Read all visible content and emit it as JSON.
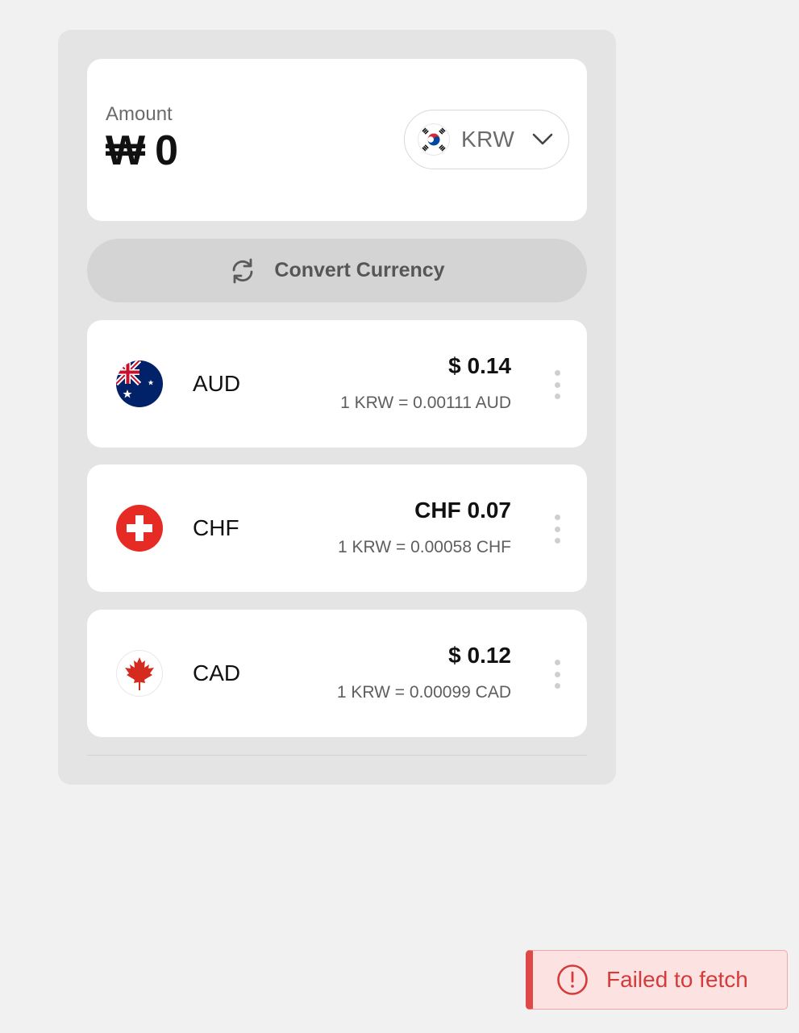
{
  "amount": {
    "label": "Amount",
    "symbol": "₩",
    "value": "0"
  },
  "currency_select": {
    "code": "KRW",
    "flag_icon": "south-korea-flag-icon"
  },
  "convert_button": {
    "label": "Convert Currency",
    "icon": "refresh-icon"
  },
  "rates": [
    {
      "code": "AUD",
      "converted": "$ 0.14",
      "rate": "1 KRW = 0.00111 AUD",
      "flag_icon": "australia-flag-icon"
    },
    {
      "code": "CHF",
      "converted": "CHF 0.07",
      "rate": "1 KRW = 0.00058 CHF",
      "flag_icon": "switzerland-flag-icon"
    },
    {
      "code": "CAD",
      "converted": "$ 0.12",
      "rate": "1 KRW = 0.00099 CAD",
      "flag_icon": "canada-flag-icon"
    }
  ],
  "toast": {
    "message": "Failed to fetch",
    "icon": "alert-circle-icon"
  },
  "colors": {
    "page_bg": "#f1f1f1",
    "panel_bg": "#e4e4e4",
    "card_bg": "#ffffff",
    "button_bg": "#d4d4d4",
    "toast_bg": "#fde2e2",
    "toast_accent": "#e04848"
  }
}
